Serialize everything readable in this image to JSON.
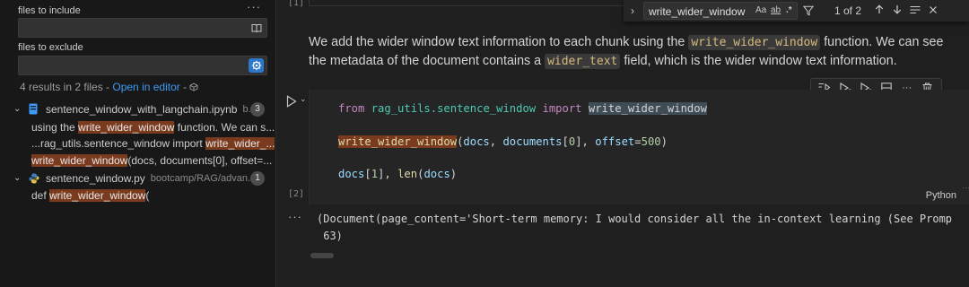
{
  "search_panel": {
    "more_label": "···",
    "files_to_include_label": "files to include",
    "files_to_include_value": "",
    "files_to_exclude_label": "files to exclude",
    "files_to_exclude_value": "",
    "summary_text": "4 results in 2 files - ",
    "open_in_editor": "Open in editor",
    "summary_suffix": " - ",
    "results": [
      {
        "file_name": "sentence_window_with_langchain.ipynb",
        "path": "b...",
        "count": "3",
        "matches": [
          {
            "before": "using the ",
            "match": "write_wider_window",
            "after": " function. We can s..."
          },
          {
            "before": "...rag_utils.sentence_window import ",
            "match": "write_wider_...",
            "after": ""
          },
          {
            "before": "",
            "match": "write_wider_window",
            "after": "(docs, documents[0], offset=..."
          }
        ]
      },
      {
        "file_name": "sentence_window.py",
        "path": "bootcamp/RAG/advan...",
        "count": "1",
        "matches": [
          {
            "before": "def ",
            "match": "write_wider_window",
            "after": "("
          }
        ]
      }
    ]
  },
  "find_widget": {
    "query": "write_wider_window",
    "opt_case": "Aa",
    "opt_word": "ab",
    "opt_regex": ".*",
    "count": "1 of 2"
  },
  "notebook": {
    "prev_exec_count": "[1]",
    "markdown": {
      "part1": "We add the wider window text information to each chunk using the ",
      "code1": "write_wider_window",
      "part2": " function. We can see the metadata of the document contains a ",
      "code2": "wider_text",
      "part3": " field, which is the wider window text information."
    },
    "code_cell": {
      "exec_count": "[2]",
      "language": "Python",
      "line1": {
        "kw_from": "from",
        "module": "rag_utils.sentence_window",
        "kw_import": "import",
        "name": "write_wider_window"
      },
      "line2": {
        "fn": "write_wider_window",
        "open": "(",
        "a1": "docs",
        "sep1": ", ",
        "a2": "documents",
        "idx_open": "[",
        "idx": "0",
        "idx_close": "]",
        "sep2": ", ",
        "kwarg": "offset",
        "eq": "=",
        "val": "500",
        "close": ")"
      },
      "line3": {
        "a1": "docs",
        "idx_open": "[",
        "idx": "1",
        "idx_close": "]",
        "sep": ", ",
        "fn": "len",
        "open": "(",
        "a2": "docs",
        "close": ")"
      }
    },
    "output_dots": "···",
    "output_line1": "(Document(page_content='Short-term memory: I would consider all the in-context learning (See Promp",
    "output_line2": " 63)"
  }
}
